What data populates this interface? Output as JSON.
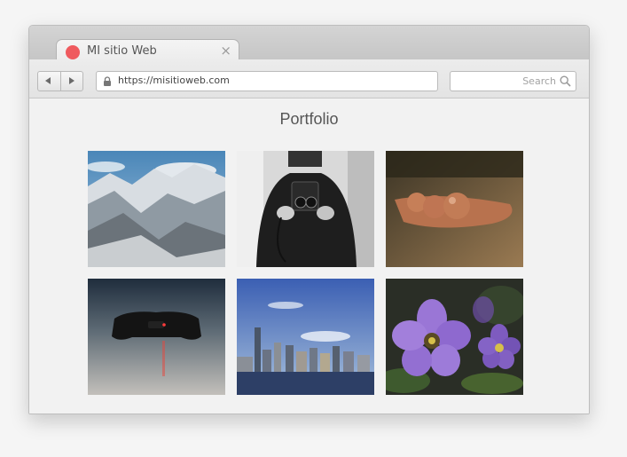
{
  "browser": {
    "tab_title": "MI sitio Web",
    "tab_close": "×",
    "url": "https://misitioweb.com",
    "search_placeholder": "Search"
  },
  "page": {
    "title": "Portfolio"
  },
  "gallery": {
    "items": [
      {
        "subject": "snowy mountains"
      },
      {
        "subject": "person holding vintage camera"
      },
      {
        "subject": "wooden spoons with nuts"
      },
      {
        "subject": "game controller"
      },
      {
        "subject": "city skyline"
      },
      {
        "subject": "purple flowers"
      }
    ]
  },
  "colors": {
    "tab_dot": "#ef5a5e",
    "window_bg": "#f2f2f2"
  }
}
